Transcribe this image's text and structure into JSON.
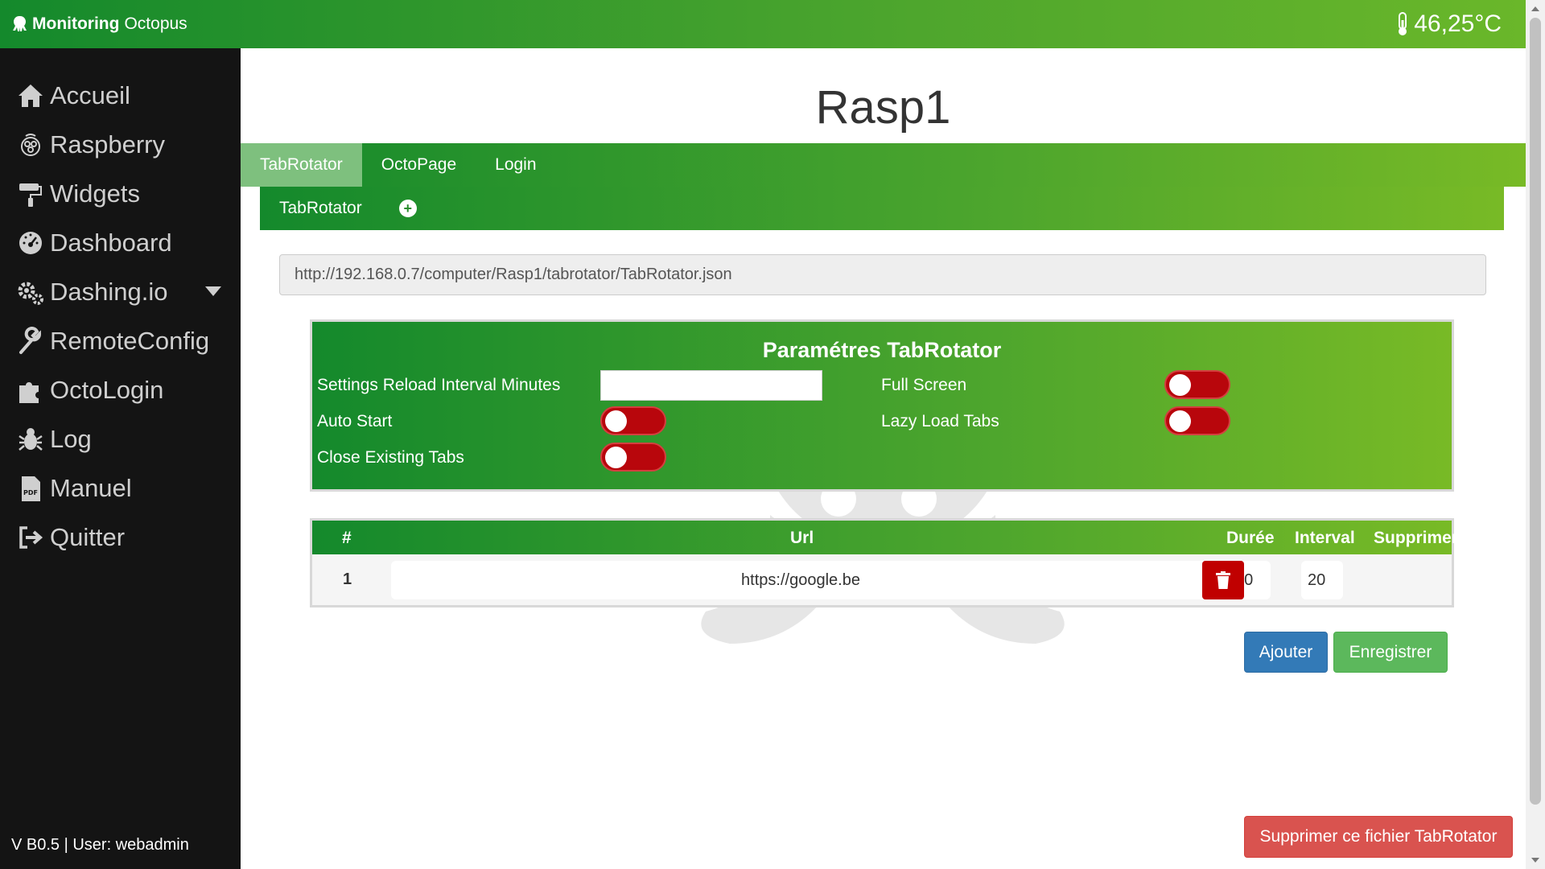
{
  "header": {
    "brand_bold": "Monitoring",
    "brand_rest": "Octopus",
    "temperature": "46,25°C"
  },
  "sidebar": {
    "items": [
      {
        "label": "Accueil",
        "icon": "home-icon"
      },
      {
        "label": "Raspberry",
        "icon": "raspberry-icon"
      },
      {
        "label": "Widgets",
        "icon": "paint-roller-icon"
      },
      {
        "label": "Dashboard",
        "icon": "dashboard-icon"
      },
      {
        "label": "Dashing.io",
        "icon": "cogs-icon",
        "has_dropdown": true
      },
      {
        "label": "RemoteConfig",
        "icon": "wrench-icon"
      },
      {
        "label": "OctoLogin",
        "icon": "puzzle-icon"
      },
      {
        "label": "Log",
        "icon": "bug-icon"
      },
      {
        "label": "Manuel",
        "icon": "pdf-icon"
      },
      {
        "label": "Quitter",
        "icon": "sign-out-icon"
      }
    ],
    "footer": "V B0.5 | User: webadmin"
  },
  "main": {
    "title": "Rasp1",
    "tabs": [
      {
        "label": "TabRotator",
        "active": true
      },
      {
        "label": "OctoPage",
        "active": false
      },
      {
        "label": "Login",
        "active": false
      }
    ],
    "subtabs": [
      {
        "label": "TabRotator"
      }
    ],
    "url": "http://192.168.0.7/computer/Rasp1/tabrotator/TabRotator.json",
    "params": {
      "title": "Paramétres TabRotator",
      "reload_label": "Settings Reload Interval Minutes",
      "reload_value": "",
      "auto_start_label": "Auto Start",
      "auto_start": false,
      "close_tabs_label": "Close Existing Tabs",
      "close_tabs": false,
      "full_screen_label": "Full Screen",
      "full_screen": false,
      "lazy_load_label": "Lazy Load Tabs",
      "lazy_load": false
    },
    "table": {
      "headers": [
        "#",
        "Url",
        "Durée",
        "Interval",
        "Supprimer"
      ],
      "rows": [
        {
          "num": "1",
          "url": "https://google.be",
          "duree": "10",
          "interval": "20"
        }
      ]
    },
    "buttons": {
      "add": "Ajouter",
      "save": "Enregistrer",
      "delete_file": "Supprimer ce fichier TabRotator"
    }
  },
  "colors": {
    "green_dark": "#14892c",
    "green_light": "#78ba26",
    "toggle_off": "#b8060c",
    "add_blue": "#337ab7",
    "save_green": "#5cb85c",
    "delete_red": "#d9534f"
  }
}
